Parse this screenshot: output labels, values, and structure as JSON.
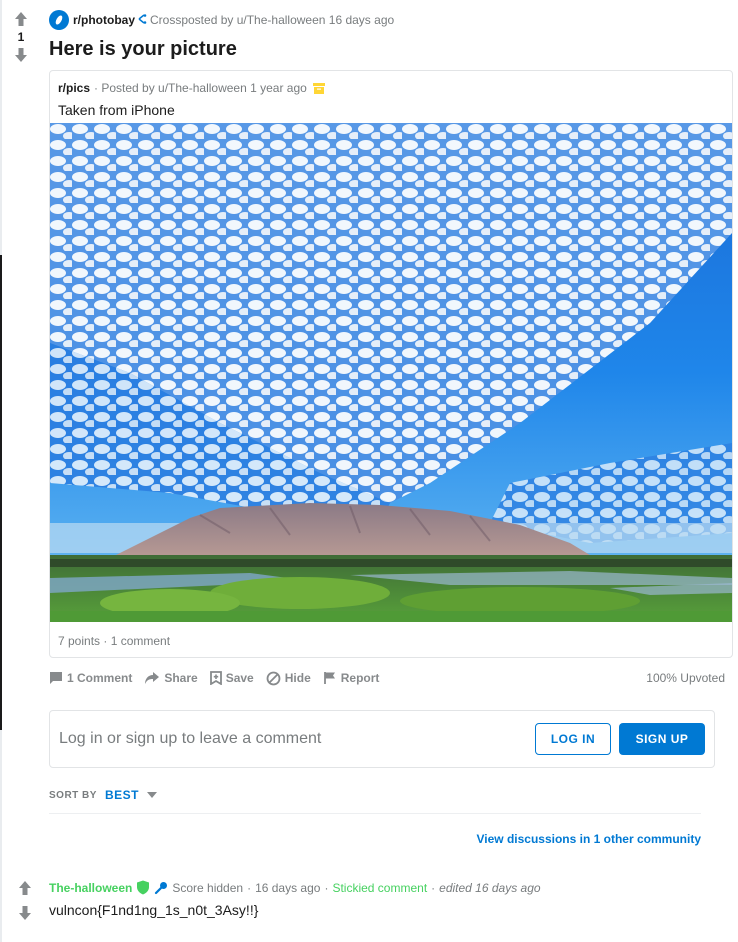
{
  "post": {
    "score": "1",
    "subreddit": "r/photobay",
    "crosspost_text": "Crossposted by u/The-halloween",
    "time_ago": "16 days ago",
    "title": "Here is your picture",
    "icon": "subreddit-icon"
  },
  "crosspost": {
    "subreddit": "r/pics",
    "posted_by": "· Posted by u/The-halloween",
    "time_ago": "1 year ago",
    "title": "Taken from iPhone",
    "footer": "7 points · 1 comment",
    "archive_color": "#ffd635"
  },
  "actions": {
    "comment": "1 Comment",
    "share": "Share",
    "save": "Save",
    "hide": "Hide",
    "report": "Report",
    "upvoted": "100% Upvoted"
  },
  "comment_box": {
    "prompt": "Log in or sign up to leave a comment",
    "login": "LOG IN",
    "signup": "SIGN UP"
  },
  "sort": {
    "label": "SORT BY",
    "value": "BEST"
  },
  "other_discussions": "View discussions in 1 other community",
  "comment": {
    "author": "The-halloween",
    "score": "Score hidden",
    "time": "16 days ago",
    "stickied": "Stickied comment",
    "edited": "edited 16 days ago",
    "body": "vulncon{F1nd1ng_1s_n0t_3Asy!!}",
    "author_color": "#46d160"
  },
  "colors": {
    "accent": "#0079d3",
    "muted": "#787c7e",
    "mod_green": "#46d160"
  }
}
